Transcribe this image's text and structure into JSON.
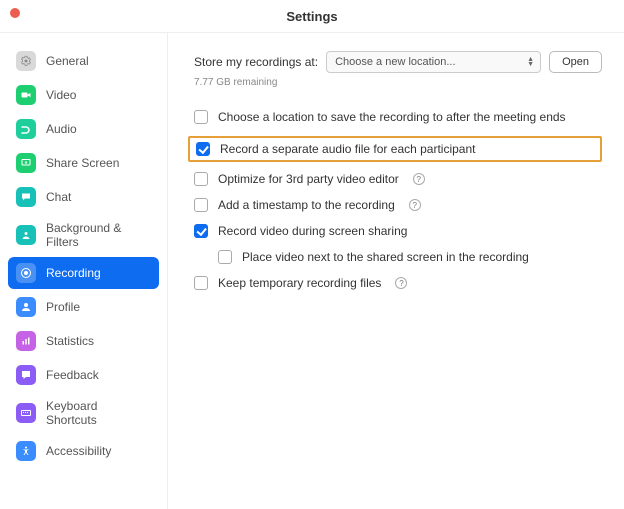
{
  "window": {
    "title": "Settings",
    "close_color": "#ec5e4f"
  },
  "sidebar": {
    "items": [
      {
        "label": "General",
        "icon": "cog-icon",
        "bg": "#d9d9d9",
        "fg": "#888",
        "active": false
      },
      {
        "label": "Video",
        "icon": "video-icon",
        "bg": "#1ecf71",
        "fg": "#fff",
        "active": false
      },
      {
        "label": "Audio",
        "icon": "audio-icon",
        "bg": "#1ecf9c",
        "fg": "#fff",
        "active": false
      },
      {
        "label": "Share Screen",
        "icon": "share-icon",
        "bg": "#1ecf71",
        "fg": "#fff",
        "active": false
      },
      {
        "label": "Chat",
        "icon": "chat-icon",
        "bg": "#17c1b7",
        "fg": "#fff",
        "active": false
      },
      {
        "label": "Background & Filters",
        "icon": "bg-icon",
        "bg": "#17c1b7",
        "fg": "#fff",
        "active": false
      },
      {
        "label": "Recording",
        "icon": "record-icon",
        "bg": "rgba(255,255,255,0.25)",
        "fg": "#fff",
        "active": true
      },
      {
        "label": "Profile",
        "icon": "profile-icon",
        "bg": "#3a8cff",
        "fg": "#fff",
        "active": false
      },
      {
        "label": "Statistics",
        "icon": "stats-icon",
        "bg": "#c562e6",
        "fg": "#fff",
        "active": false
      },
      {
        "label": "Feedback",
        "icon": "feedback-icon",
        "bg": "#8b5cf6",
        "fg": "#fff",
        "active": false
      },
      {
        "label": "Keyboard Shortcuts",
        "icon": "keyboard-icon",
        "bg": "#8b5cf6",
        "fg": "#fff",
        "active": false
      },
      {
        "label": "Accessibility",
        "icon": "accessibility-icon",
        "bg": "#3a8cff",
        "fg": "#fff",
        "active": false
      }
    ]
  },
  "main": {
    "store_label": "Store my recordings at:",
    "select_value": "Choose a new location...",
    "open_label": "Open",
    "remaining": "7.77 GB remaining",
    "options": [
      {
        "label": "Choose a location to save the recording to after the meeting ends",
        "checked": false,
        "help": false,
        "indent": 0,
        "highlight": false
      },
      {
        "label": "Record a separate audio file for each participant",
        "checked": true,
        "help": false,
        "indent": 0,
        "highlight": true
      },
      {
        "label": "Optimize for 3rd party video editor",
        "checked": false,
        "help": true,
        "indent": 0,
        "highlight": false
      },
      {
        "label": "Add a timestamp to the recording",
        "checked": false,
        "help": true,
        "indent": 0,
        "highlight": false
      },
      {
        "label": "Record video during screen sharing",
        "checked": true,
        "help": false,
        "indent": 0,
        "highlight": false
      },
      {
        "label": "Place video next to the shared screen in the recording",
        "checked": false,
        "help": false,
        "indent": 1,
        "highlight": false
      },
      {
        "label": "Keep temporary recording files",
        "checked": false,
        "help": true,
        "indent": 0,
        "highlight": false
      }
    ]
  }
}
